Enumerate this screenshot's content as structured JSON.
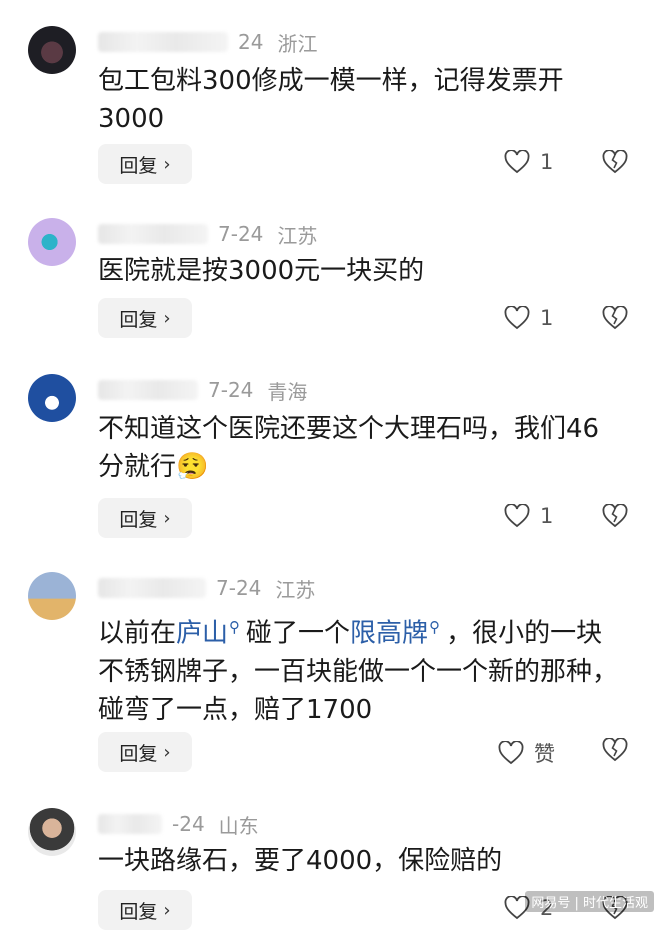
{
  "comments": [
    {
      "date": "24",
      "location": "浙江",
      "text": "包工包料300修成一模一样，记得发票开3000",
      "reply_label": "回复",
      "like_count": "1"
    },
    {
      "date": "7-24",
      "location": "江苏",
      "text": "医院就是按3000元一块买的",
      "reply_label": "回复",
      "like_count": "1"
    },
    {
      "date": "7-24",
      "location": "青海",
      "text_line1": "不知道这个医院还要这个大理石吗，我们46",
      "text_line2": "分就行",
      "emoji": "😮‍💨",
      "reply_label": "回复",
      "like_count": "1"
    },
    {
      "date": "7-24",
      "location": "江苏",
      "text_p1": "以前在",
      "link1": "庐山",
      "text_p2": "碰了一个",
      "link2": "限高牌",
      "text_p3": "，很小的一块不锈钢牌子，一百块能做一个一个新的那种，碰弯了一点，赔了1700",
      "reply_label": "回复",
      "like_label": "赞"
    },
    {
      "date": "-24",
      "location": "山东",
      "text": "一块路缘石，要了4000，保险赔的",
      "reply_label": "回复",
      "like_count": "2"
    }
  ],
  "watermark": "网易号 | 时代生活观",
  "colors": {
    "link": "#2c5fa8",
    "meta": "#9a9a9a",
    "reply_bg": "#f2f2f2"
  }
}
